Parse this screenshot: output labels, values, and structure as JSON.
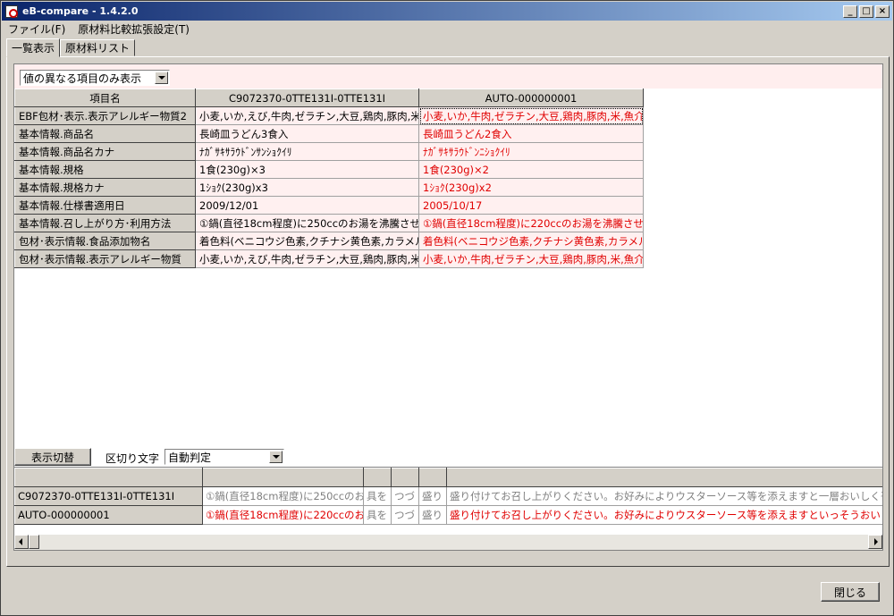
{
  "window": {
    "title": "eB-compare - 1.4.2.0",
    "min": "_",
    "max": "□",
    "close": "×"
  },
  "menu": [
    "ファイル(F)",
    "原材料比較拡張設定(T)"
  ],
  "tabs": [
    {
      "label": "一覧表示",
      "active": true
    },
    {
      "label": "原材料リスト",
      "active": false
    }
  ],
  "filter": {
    "value": "値の異なる項目のみ表示"
  },
  "grid": {
    "headers": [
      "項目名",
      "C9072370-0TTE131I-0TTE131I",
      "AUTO-000000001"
    ],
    "rows": [
      [
        "EBF包材･表示.表示アレルギー物質2",
        "小麦,いか,えび,牛肉,ゼラチン,大豆,鶏肉,豚肉,米,ﾘ",
        "小麦,いか,牛肉,ゼラチン,大豆,鶏肉,豚肉,米,魚介ﾘ"
      ],
      [
        "基本情報.商品名",
        "長崎皿うどん3食入",
        "長崎皿うどん2食入"
      ],
      [
        "基本情報.商品名カナ",
        "ﾅｶﾞｻｷｻﾗｳﾄﾞﾝｻﾝｼｮｸｲﾘ",
        "ﾅｶﾞｻｷｻﾗｳﾄﾞﾝﾆｼｮｸｲﾘ"
      ],
      [
        "基本情報.規格",
        "1食(230g)×3",
        "1食(230g)×2"
      ],
      [
        "基本情報.規格カナ",
        "1ｼｮｸ(230g)x3",
        "1ｼｮｸ(230g)x2"
      ],
      [
        "基本情報.仕様書適用日",
        "2009/12/01",
        "2005/10/17"
      ],
      [
        "基本情報.召し上がり方･利用方法",
        "①鍋(直径18cm程度)に250ccのお湯を沸騰させ",
        "①鍋(直径18cm程度)に220ccのお湯を沸騰させ"
      ],
      [
        "包材･表示情報.食品添加物名",
        "着色料(ベニコウジ色素,クチナシ黄色素,カラメル",
        "着色料(ベニコウジ色素,クチナシ黄色素,カラメル"
      ],
      [
        "包材･表示情報.表示アレルギー物質",
        "小麦,いか,えび,牛肉,ゼラチン,大豆,鶏肉,豚肉,米,ﾘ",
        "小麦,いか,牛肉,ゼラチン,大豆,鶏肉,豚肉,米,魚介ﾘ"
      ]
    ]
  },
  "toolbar": {
    "toggle_label": "表示切替",
    "delimiter_label": "区切り文字",
    "delimiter_value": "自動判定"
  },
  "detail": {
    "rows": [
      {
        "id": "C9072370-0TTE131I-0TTE131I",
        "cells": [
          "①鍋(直径18cm程度)に250ccのお",
          "具を",
          "つづ",
          "盛り",
          "盛り付けてお召し上がりください。お好みによりウスターソース等を添えますと一層おいしく召し上"
        ]
      },
      {
        "id": "AUTO-000000001",
        "cells": [
          "①鍋(直径18cm程度)に220ccのお",
          "具を",
          "つづ",
          "盛り",
          "盛り付けてお召し上がりください。お好みによりウスターソース等を添えますといっそうおいしく召し上"
        ]
      }
    ]
  },
  "footer": {
    "close_label": "閉じる"
  },
  "colors": {
    "diff_text": "#e00000",
    "diff_bg": "#fff0f0",
    "title_start": "#0a246a"
  }
}
